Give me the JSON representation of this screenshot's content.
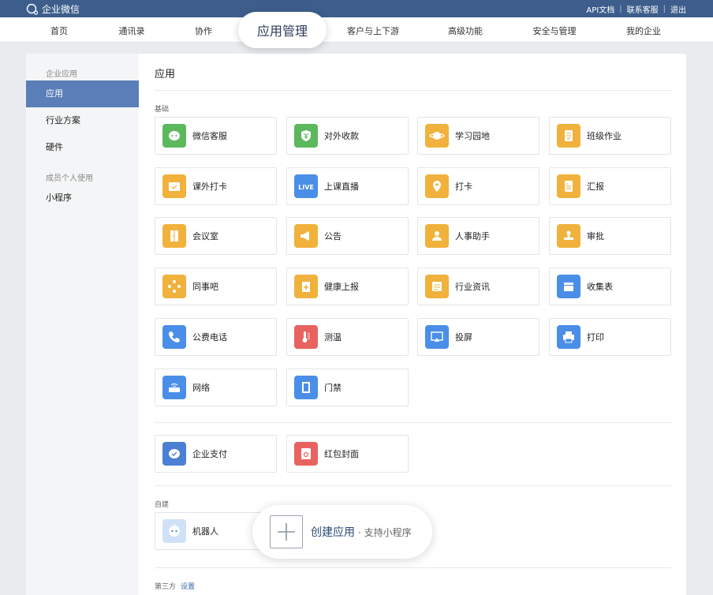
{
  "topbar": {
    "brand": "企业微信",
    "links": [
      "API文档",
      "联系客服",
      "退出"
    ]
  },
  "nav": {
    "items": [
      "首页",
      "通讯录",
      "协作",
      "客户与上下游",
      "高级功能",
      "安全与管理",
      "我的企业"
    ],
    "active": "应用管理"
  },
  "sidebar": {
    "group1": "企业应用",
    "items1": [
      "应用",
      "行业方案",
      "硬件"
    ],
    "group2": "成员个人使用",
    "items2": [
      "小程序"
    ]
  },
  "content": {
    "title": "应用",
    "section_basic": "基础",
    "basic_apps": [
      {
        "label": "微信客服",
        "icon": "wechat-service-icon",
        "color": "#5cb85c"
      },
      {
        "label": "对外收款",
        "icon": "yuan-shield-icon",
        "color": "#5cb85c"
      },
      {
        "label": "学习园地",
        "icon": "planet-icon",
        "color": "#f0b23c"
      },
      {
        "label": "班级作业",
        "icon": "homework-icon",
        "color": "#f0b23c"
      },
      {
        "label": "课外打卡",
        "icon": "checkin-calendar-icon",
        "color": "#f0b23c"
      },
      {
        "label": "上课直播",
        "icon": "live-icon",
        "color": "#4a8ee8"
      },
      {
        "label": "打卡",
        "icon": "location-pin-icon",
        "color": "#f0b23c"
      },
      {
        "label": "汇报",
        "icon": "report-icon",
        "color": "#f0b23c"
      },
      {
        "label": "会议室",
        "icon": "door-icon",
        "color": "#f0b23c"
      },
      {
        "label": "公告",
        "icon": "megaphone-icon",
        "color": "#f0b23c"
      },
      {
        "label": "人事助手",
        "icon": "person-icon",
        "color": "#f0b23c"
      },
      {
        "label": "审批",
        "icon": "stamp-icon",
        "color": "#f0b23c"
      },
      {
        "label": "同事吧",
        "icon": "network-nodes-icon",
        "color": "#f0b23c"
      },
      {
        "label": "健康上报",
        "icon": "health-report-icon",
        "color": "#f0b23c"
      },
      {
        "label": "行业资讯",
        "icon": "news-icon",
        "color": "#f0b23c"
      },
      {
        "label": "收集表",
        "icon": "collect-box-icon",
        "color": "#4a8ee8"
      },
      {
        "label": "公费电话",
        "icon": "phone-icon",
        "color": "#4a8ee8"
      },
      {
        "label": "测温",
        "icon": "thermometer-icon",
        "color": "#e8625f"
      },
      {
        "label": "投屏",
        "icon": "screen-cast-icon",
        "color": "#4a8ee8"
      },
      {
        "label": "打印",
        "icon": "printer-icon",
        "color": "#4a8ee8"
      },
      {
        "label": "网络",
        "icon": "router-icon",
        "color": "#4a8ee8"
      },
      {
        "label": "门禁",
        "icon": "access-door-icon",
        "color": "#4a8ee8"
      }
    ],
    "extra_apps": [
      {
        "label": "企业支付",
        "icon": "enterprise-pay-icon",
        "color": "#4a7fd4"
      },
      {
        "label": "红包封面",
        "icon": "red-envelope-icon",
        "color": "#e8625f"
      }
    ],
    "section_self": "自建",
    "self_apps": [
      {
        "label": "机器人",
        "icon": "robot-icon",
        "color": "#cfe1f7"
      }
    ],
    "create": {
      "label": "创建应用",
      "sub": "· 支持小程序"
    },
    "section_third": "第三方",
    "third_link": "设置"
  }
}
